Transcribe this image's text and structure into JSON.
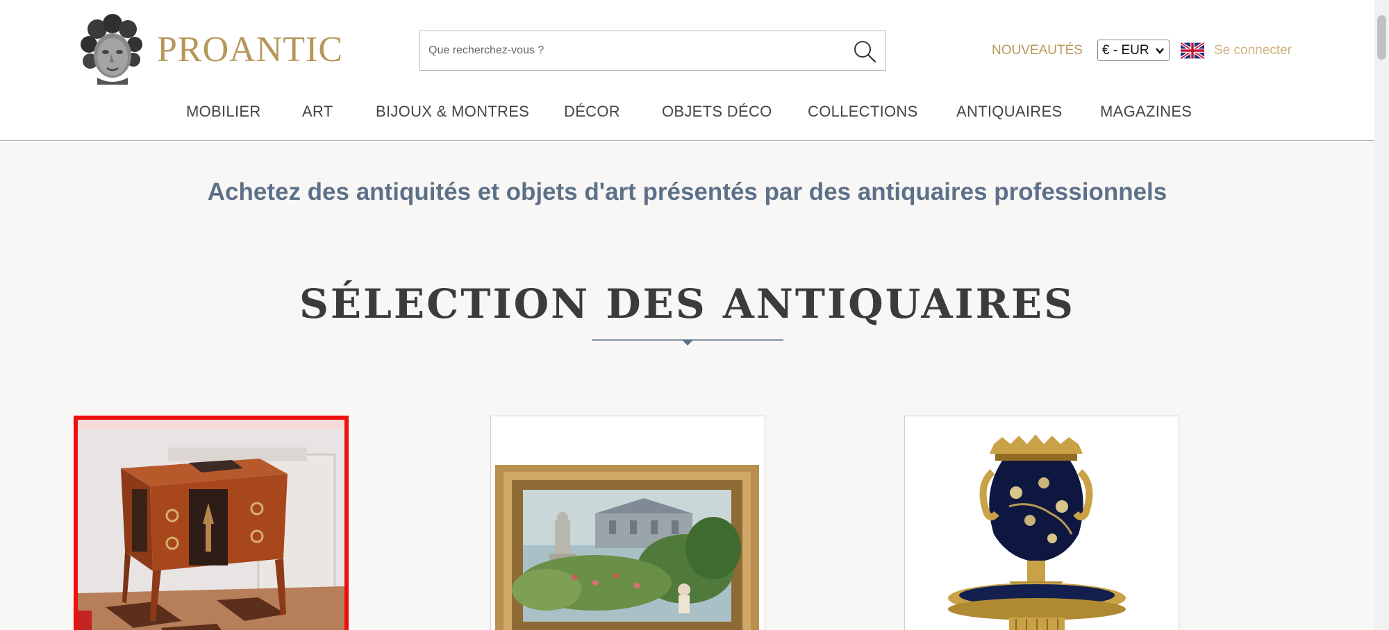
{
  "header": {
    "logo_text": "PROANTIC",
    "search": {
      "placeholder": "Que recherchez-vous ?",
      "value": ""
    },
    "nouveautes_label": "NOUVEAUTÉS",
    "currency_selected": "€ - EUR",
    "language_icon": "uk-flag-icon",
    "login_label": "Se connecter"
  },
  "nav": {
    "items": [
      {
        "label": "MOBILIER"
      },
      {
        "label": "ART"
      },
      {
        "label": "BIJOUX & MONTRES"
      },
      {
        "label": "DÉCOR"
      },
      {
        "label": "OBJETS DÉCO"
      },
      {
        "label": "COLLECTIONS"
      },
      {
        "label": "ANTIQUAIRES"
      },
      {
        "label": "MAGAZINES"
      }
    ]
  },
  "main": {
    "tagline": "Achetez des antiquités et objets d'art présentés par des antiquaires professionnels",
    "section_title": "SÉLECTION DES ANTIQUAIRES",
    "products": [
      {
        "icon": "commode-image",
        "selected": true
      },
      {
        "icon": "painting-image",
        "selected": false
      },
      {
        "icon": "vase-image",
        "selected": false
      }
    ]
  },
  "colors": {
    "brand_gold": "#b6975b",
    "tagline_blue": "#5c7089",
    "selection_red": "#ee0f0f"
  }
}
